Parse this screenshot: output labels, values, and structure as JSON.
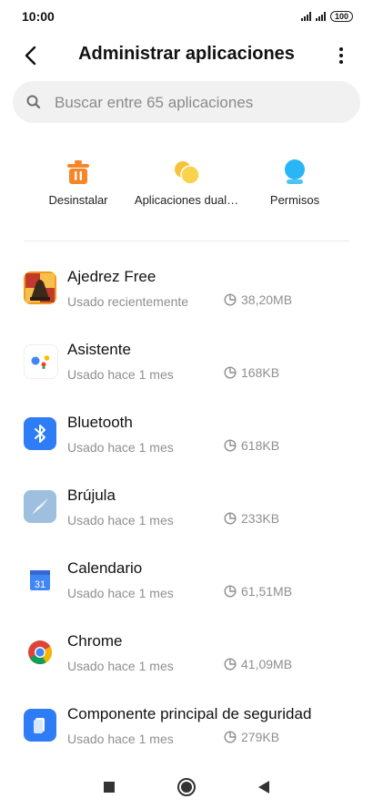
{
  "status_bar": {
    "time": "10:00",
    "battery": "100"
  },
  "header": {
    "title": "Administrar aplicaciones"
  },
  "search": {
    "placeholder": "Buscar entre 65 aplicaciones"
  },
  "actions": [
    {
      "label": "Desinstalar",
      "icon": "trash-icon",
      "color": "#f5862a"
    },
    {
      "label": "Aplicaciones dual…",
      "icon": "dual-apps-icon",
      "color": "#f9c23c"
    },
    {
      "label": "Permisos",
      "icon": "permissions-icon",
      "color": "#29b6f6"
    }
  ],
  "apps": [
    {
      "name": "Ajedrez Free",
      "usage": "Usado recientemente",
      "size": "38,20MB",
      "icon": "chess-app-icon"
    },
    {
      "name": "Asistente",
      "usage": "Usado hace 1 mes",
      "size": "168KB",
      "icon": "assistant-app-icon"
    },
    {
      "name": "Bluetooth",
      "usage": "Usado hace 1 mes",
      "size": "618KB",
      "icon": "bluetooth-app-icon"
    },
    {
      "name": "Brújula",
      "usage": "Usado hace 1 mes",
      "size": "233KB",
      "icon": "compass-app-icon"
    },
    {
      "name": "Calendario",
      "usage": "Usado hace 1 mes",
      "size": "61,51MB",
      "icon": "calendar-app-icon",
      "icon_text": "31"
    },
    {
      "name": "Chrome",
      "usage": "Usado hace 1 mes",
      "size": "41,09MB",
      "icon": "chrome-app-icon"
    },
    {
      "name": "Componente principal de seguridad",
      "usage": "Usado hace 1 mes",
      "size": "279KB",
      "icon": "security-app-icon"
    }
  ],
  "colors": {
    "accent_blue": "#2f7df6",
    "text_secondary": "#8f8f8f"
  }
}
